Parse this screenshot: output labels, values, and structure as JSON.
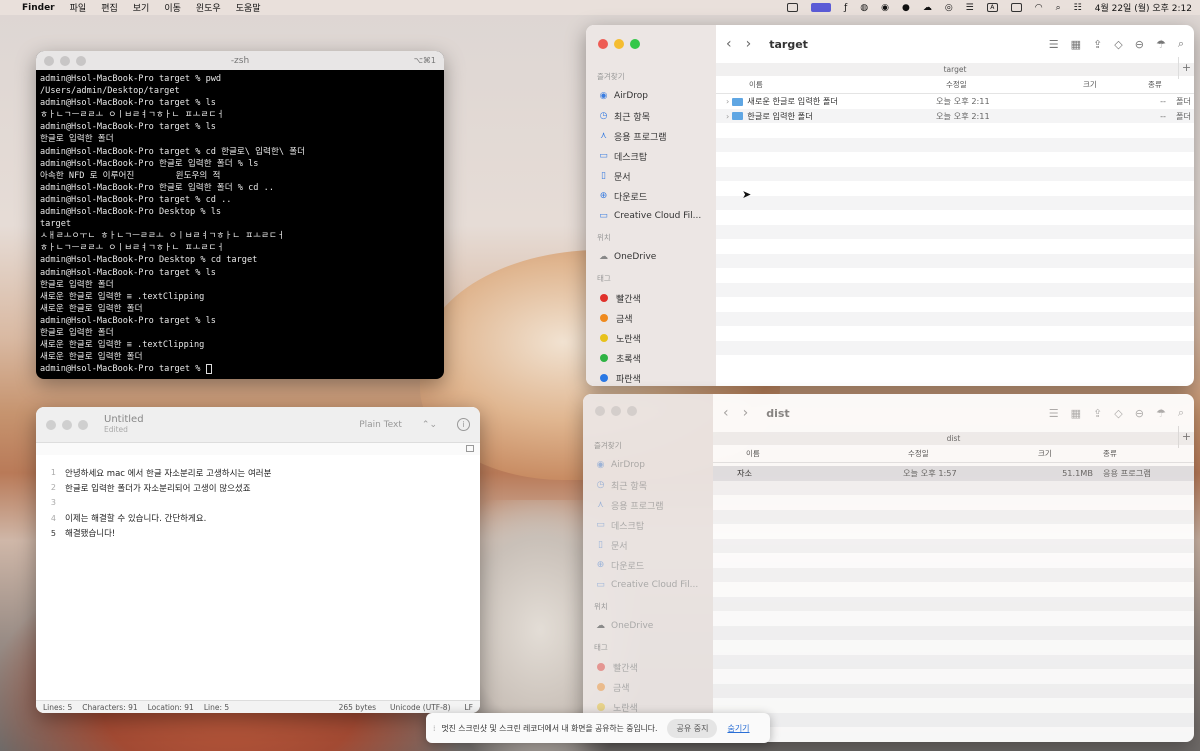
{
  "menubar": {
    "app": "Finder",
    "items": [
      "파일",
      "편집",
      "보기",
      "이동",
      "윈도우",
      "도움말"
    ],
    "datetime": "4월 22일 (월) 오후 2:12"
  },
  "terminal": {
    "title": "-zsh",
    "shortcut": "⌥⌘1",
    "lines": [
      "admin@Hsol-MacBook-Pro target % pwd",
      "/Users/admin/Desktop/target",
      "admin@Hsol-MacBook-Pro target % ls",
      "ㅎㅏㄴㄱㅡㄹㄹㅗ ㅇㅣㅂㄹㅕㄱㅎㅏㄴ ㅍㅗㄹㄷㅓ",
      "admin@Hsol-MacBook-Pro target % ls",
      "한글로 입력한 폴더",
      "admin@Hsol-MacBook-Pro target % cd 한글로\\ 입력한\\ 폴더",
      "admin@Hsol-MacBook-Pro 한글로 입력한 폴더 % ls",
      "아속한 NFD 로 이루어진        윈도우의 적",
      "admin@Hsol-MacBook-Pro 한글로 입력한 폴더 % cd ..",
      "admin@Hsol-MacBook-Pro target % cd ..",
      "admin@Hsol-MacBook-Pro Desktop % ls",
      "target",
      "ㅅㅐㄹㅗㅇㅜㄴ ㅎㅏㄴㄱㅡㄹㄹㅗ ㅇㅣㅂㄹㅕㄱㅎㅏㄴ ㅍㅗㄹㄷㅓ",
      "ㅎㅏㄴㄱㅡㄹㄹㅗ ㅇㅣㅂㄹㅕㄱㅎㅏㄴ ㅍㅗㄹㄷㅓ",
      "admin@Hsol-MacBook-Pro Desktop % cd target",
      "admin@Hsol-MacBook-Pro target % ls",
      "한글로 입력한 폴더",
      "새로운 한글로 입력한 ≡ .textClipping",
      "새로운 한글로 입력한 폴더",
      "admin@Hsol-MacBook-Pro target % ls",
      "한글로 입력한 폴더",
      "새로운 한글로 입력한 ≡ .textClipping",
      "새로운 한글로 입력한 폴더",
      "admin@Hsol-MacBook-Pro target % "
    ]
  },
  "textedit": {
    "title": "Untitled",
    "subtitle": "Edited",
    "format": "Plain Text",
    "lines": [
      {
        "n": "1",
        "text": "안녕하세요 mac 에서 한글 자소분리로 고생하시는 여러분"
      },
      {
        "n": "2",
        "text": "한글로 입력한 폴더가 자소분리되어 고생이 많으셨죠"
      },
      {
        "n": "3",
        "text": ""
      },
      {
        "n": "4",
        "text": "이제는 해결할 수 있습니다. 간단하게요."
      },
      {
        "n": "5",
        "text": "해결됐습니다!"
      }
    ],
    "status": {
      "lines": "Lines: 5",
      "characters": "Characters: 91",
      "location": "Location: 91",
      "line": "Line: 5",
      "bytes": "265 bytes",
      "encoding": "Unicode (UTF-8)",
      "lf": "LF"
    }
  },
  "finder1": {
    "title": "target",
    "path": "target",
    "sidebar": {
      "favorites_header": "즐겨찾기",
      "favorites": [
        {
          "icon": "airdrop-icon",
          "glyph": "◉",
          "label": "AirDrop"
        },
        {
          "icon": "recents-icon",
          "glyph": "◷",
          "label": "최근 항목"
        },
        {
          "icon": "applications-icon",
          "glyph": "⋏",
          "label": "응용 프로그램"
        },
        {
          "icon": "desktop-icon",
          "glyph": "▭",
          "label": "데스크탑"
        },
        {
          "icon": "document-icon",
          "glyph": "▯",
          "label": "문서"
        },
        {
          "icon": "downloads-icon",
          "glyph": "⊕",
          "label": "다운로드"
        },
        {
          "icon": "folder-icon",
          "glyph": "▭",
          "label": "Creative Cloud Fil..."
        }
      ],
      "locations_header": "위치",
      "locations": [
        {
          "icon": "cloud-icon",
          "glyph": "☁",
          "label": "OneDrive"
        }
      ],
      "tags_header": "태그",
      "tags": [
        {
          "label": "빨간색",
          "color": "#e0312b"
        },
        {
          "label": "금색",
          "color": "#ef8a1e"
        },
        {
          "label": "노란색",
          "color": "#e8c21c"
        },
        {
          "label": "초록색",
          "color": "#2fb344"
        },
        {
          "label": "파란색",
          "color": "#2a78e4"
        }
      ]
    },
    "columns": {
      "name": "이름",
      "modified": "수정일",
      "size": "크기",
      "kind": "종류"
    },
    "rows": [
      {
        "name": "새로운 한글로 입력한 폴더",
        "modified": "오늘 오후 2:11",
        "size": "--",
        "kind": "폴더"
      },
      {
        "name": "한글로 입력한 폴더",
        "modified": "오늘 오후 2:11",
        "size": "--",
        "kind": "폴더"
      }
    ]
  },
  "finder2": {
    "title": "dist",
    "path": "dist",
    "columns": {
      "name": "이름",
      "modified": "수정일",
      "size": "크기",
      "kind": "종류"
    },
    "rows": [
      {
        "name": "자소",
        "modified": "오늘 오후 1:57",
        "size": "51.1MB",
        "kind": "응용 프로그램"
      }
    ]
  },
  "notice": {
    "text": "멋진 스크린샷 및 스크린 레코더에서 내 화면을 공유하는 중입니다.",
    "stop_label": "공유 중지",
    "hide_label": "숨기기"
  }
}
